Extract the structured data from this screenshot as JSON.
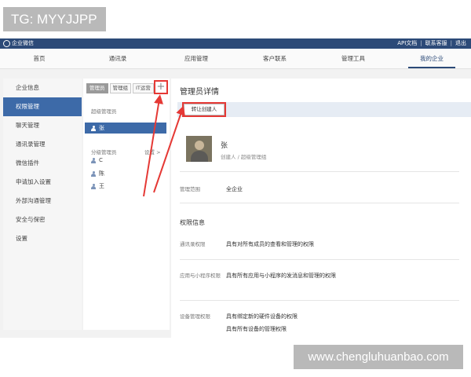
{
  "overlays": {
    "tag": "TG: MYYJJPP",
    "site": "www.chengluhuanbao.com"
  },
  "topbar": {
    "app_name": "企业微信",
    "links": [
      "API文档",
      "联系客服",
      "退出"
    ],
    "separator": "|"
  },
  "nav": {
    "items": [
      "首页",
      "通讯录",
      "应用管理",
      "客户联系",
      "管理工具",
      "我的企业"
    ],
    "active_index": 5
  },
  "sidebar": {
    "items": [
      "企业信息",
      "权限管理",
      "聊天管理",
      "通讯录管理",
      "微信插件",
      "申请加入设置",
      "外部沟通管理",
      "安全与保密",
      "设置"
    ],
    "active_index": 1
  },
  "admin_panel": {
    "tabs": [
      "管理员",
      "管理组",
      "IT运营"
    ],
    "active_tab": 0,
    "add_symbol": "+",
    "super_admin_title": "超级管理员",
    "super_admin": "张",
    "branch_admin_title": "分级管理员",
    "settings_link": "设置 >",
    "branch_admins": [
      "C",
      "陈",
      "王"
    ]
  },
  "detail": {
    "title": "管理员详情",
    "transfer_button": "转让创建人",
    "name": "张",
    "role": "创建人 / 超级管理组",
    "scope_label": "管理范围",
    "scope_value": "全企业",
    "permissions_title": "权限信息",
    "permissions": [
      {
        "label": "通讯录权限",
        "values": [
          "具有对所有成员的查看和管理的权限"
        ]
      },
      {
        "label": "应用与小程序权限",
        "values": [
          "具有所有应用与小程序的发消息和管理的权限"
        ]
      },
      {
        "label": "设备管理权限",
        "values": [
          "具有绑定新的硬件设备的权限",
          "具有所有设备的管理权限"
        ]
      }
    ]
  },
  "colors": {
    "brand": "#2c4a78",
    "active": "#3d6aa8",
    "highlight": "#e53935"
  }
}
